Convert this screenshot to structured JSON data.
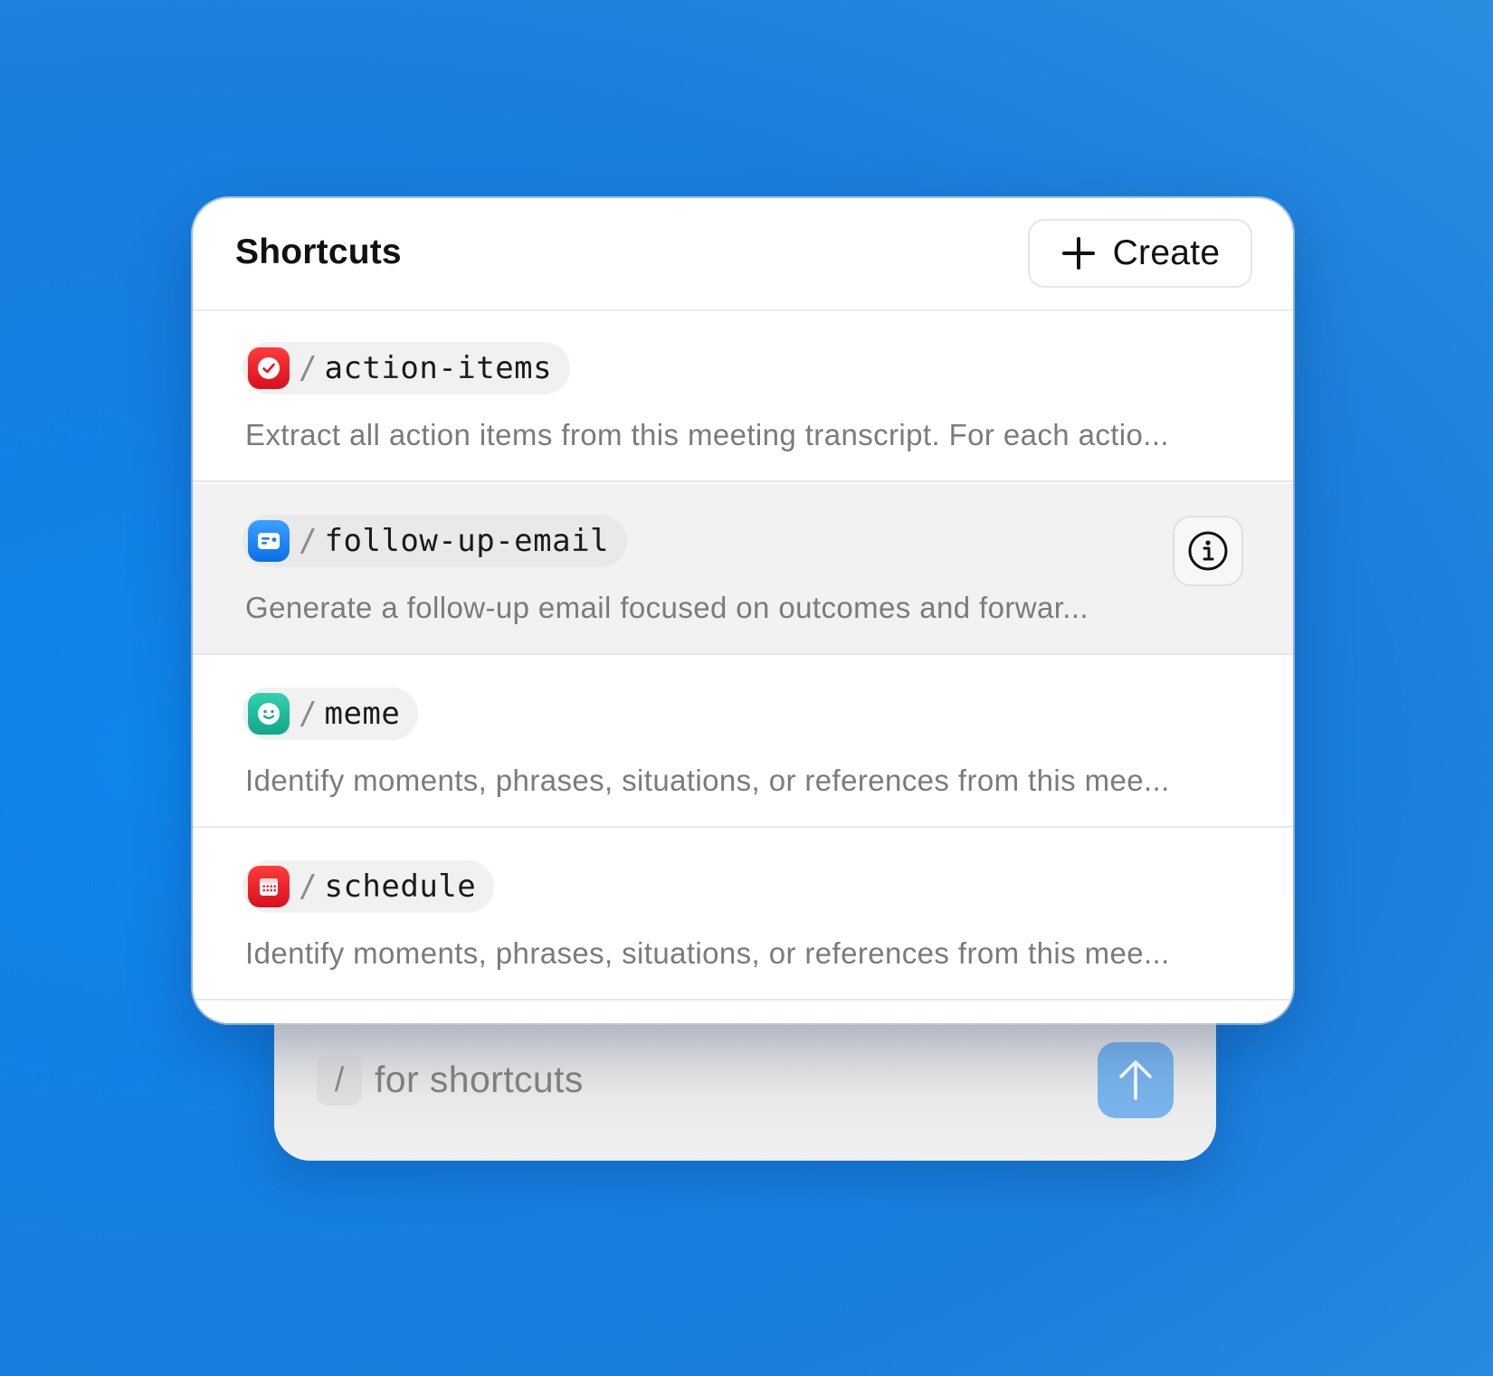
{
  "panel": {
    "title": "Shortcuts",
    "create_button": {
      "label": "Create",
      "icon": "plus-icon"
    }
  },
  "shortcuts": [
    {
      "slash": "/",
      "command": "action-items",
      "description": "Extract all action items from this meeting transcript. For each actio...",
      "icon": "checkmark-circle-icon",
      "icon_color": "#e8141f"
    },
    {
      "slash": "/",
      "command": "follow-up-email",
      "description": "Generate a follow-up email focused on outcomes and forwar...",
      "icon": "id-card-icon",
      "icon_color": "#1582f0",
      "highlighted": true,
      "trailing_icon": "info-icon"
    },
    {
      "slash": "/",
      "command": "meme",
      "description": "Identify moments, phrases, situations, or references from this mee...",
      "icon": "smiley-icon",
      "icon_color": "#1bb898"
    },
    {
      "slash": "/",
      "command": "schedule",
      "description": "Identify moments, phrases, situations, or references from this mee...",
      "icon": "calendar-icon",
      "icon_color": "#e8141f"
    }
  ],
  "input": {
    "slash_key": "/",
    "placeholder": "for shortcuts",
    "send_icon": "arrow-up-icon",
    "send_color": "#79b4ec"
  },
  "colors": {
    "background": "#137fe2",
    "panel": "#ffffff",
    "highlight_row": "#f2f2f2",
    "description_text": "#7b7b7b"
  }
}
